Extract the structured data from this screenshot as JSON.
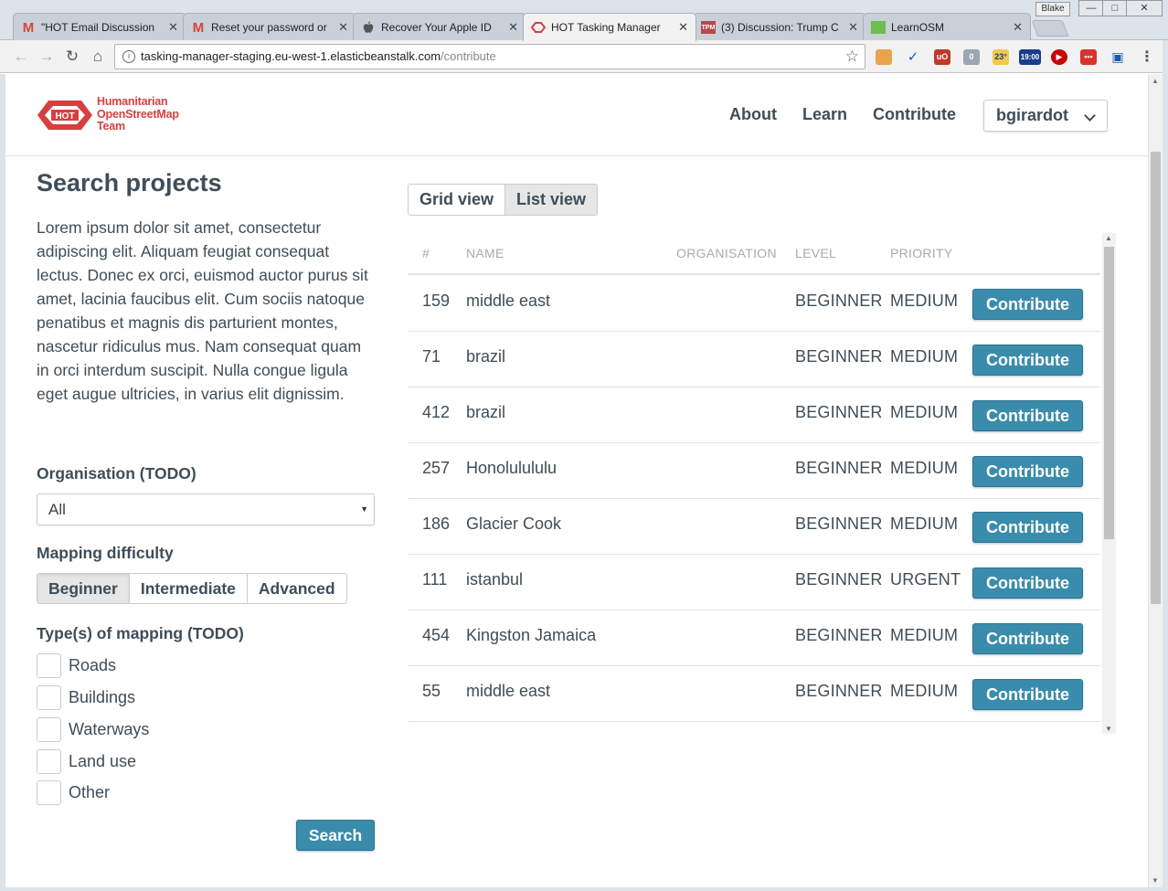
{
  "browser": {
    "tabs": [
      {
        "title": "\"HOT Email Discussion",
        "icon": "gmail-icon"
      },
      {
        "title": "Reset your password or",
        "icon": "gmail-icon"
      },
      {
        "title": "Recover Your Apple ID",
        "icon": "apple-icon"
      },
      {
        "title": "HOT Tasking Manager",
        "icon": "hot-icon"
      },
      {
        "title": "(3) Discussion: Trump C",
        "icon": "tpm-icon"
      },
      {
        "title": "LearnOSM",
        "icon": "learnosm-icon"
      }
    ],
    "active_tab": 3,
    "tab_close": "✕",
    "window_user": "Blake",
    "url_host": "tasking-manager-staging.eu-west-1.elasticbeanstalk.com",
    "url_path": "/contribute",
    "weather_badge": "23°",
    "clock_badge": "19:00",
    "ext_badge_count": "0"
  },
  "header": {
    "logo_line1": "Humanitarian",
    "logo_line2": "OpenStreetMap",
    "logo_line3": "Team",
    "logo_mark": "HOT",
    "nav": [
      "About",
      "Learn",
      "Contribute"
    ],
    "user": "bgirardot"
  },
  "sidebar": {
    "title": "Search projects",
    "intro": "Lorem ipsum dolor sit amet, consectetur adipiscing elit. Aliquam feugiat consequat lectus. Donec ex orci, euismod auctor purus sit amet, lacinia faucibus elit. Cum sociis natoque penatibus et magnis dis parturient montes, nascetur ridiculus mus. Nam consequat quam in orci interdum suscipit. Nulla congue ligula eget augue ultricies, in varius elit dignissim.",
    "organisation_label": "Organisation (TODO)",
    "organisation_value": "All",
    "difficulty_label": "Mapping difficulty",
    "difficulty_options": [
      "Beginner",
      "Intermediate",
      "Advanced"
    ],
    "difficulty_selected": "Beginner",
    "types_label": "Type(s) of mapping (TODO)",
    "types": [
      "Roads",
      "Buildings",
      "Waterways",
      "Land use",
      "Other"
    ],
    "search_button": "Search"
  },
  "main": {
    "views": [
      "Grid view",
      "List view"
    ],
    "view_selected": "List view",
    "columns": [
      "#",
      "NAME",
      "ORGANISATION",
      "LEVEL",
      "PRIORITY"
    ],
    "rows": [
      {
        "id": "159",
        "name": "middle east",
        "organisation": "",
        "level": "BEGINNER",
        "priority": "MEDIUM",
        "action": "Contribute"
      },
      {
        "id": "71",
        "name": "brazil",
        "organisation": "",
        "level": "BEGINNER",
        "priority": "MEDIUM",
        "action": "Contribute"
      },
      {
        "id": "412",
        "name": "brazil",
        "organisation": "",
        "level": "BEGINNER",
        "priority": "MEDIUM",
        "action": "Contribute"
      },
      {
        "id": "257",
        "name": "Honolulululu",
        "organisation": "",
        "level": "BEGINNER",
        "priority": "MEDIUM",
        "action": "Contribute"
      },
      {
        "id": "186",
        "name": "Glacier Cook",
        "organisation": "",
        "level": "BEGINNER",
        "priority": "MEDIUM",
        "action": "Contribute"
      },
      {
        "id": "111",
        "name": "istanbul",
        "organisation": "",
        "level": "BEGINNER",
        "priority": "URGENT",
        "action": "Contribute"
      },
      {
        "id": "454",
        "name": "Kingston Jamaica",
        "organisation": "",
        "level": "BEGINNER",
        "priority": "MEDIUM",
        "action": "Contribute"
      },
      {
        "id": "55",
        "name": "middle east",
        "organisation": "",
        "level": "BEGINNER",
        "priority": "MEDIUM",
        "action": "Contribute"
      }
    ]
  },
  "colors": {
    "brand_red": "#d73f3f",
    "button_blue": "#3a8cac",
    "heading": "#3f4d57"
  }
}
